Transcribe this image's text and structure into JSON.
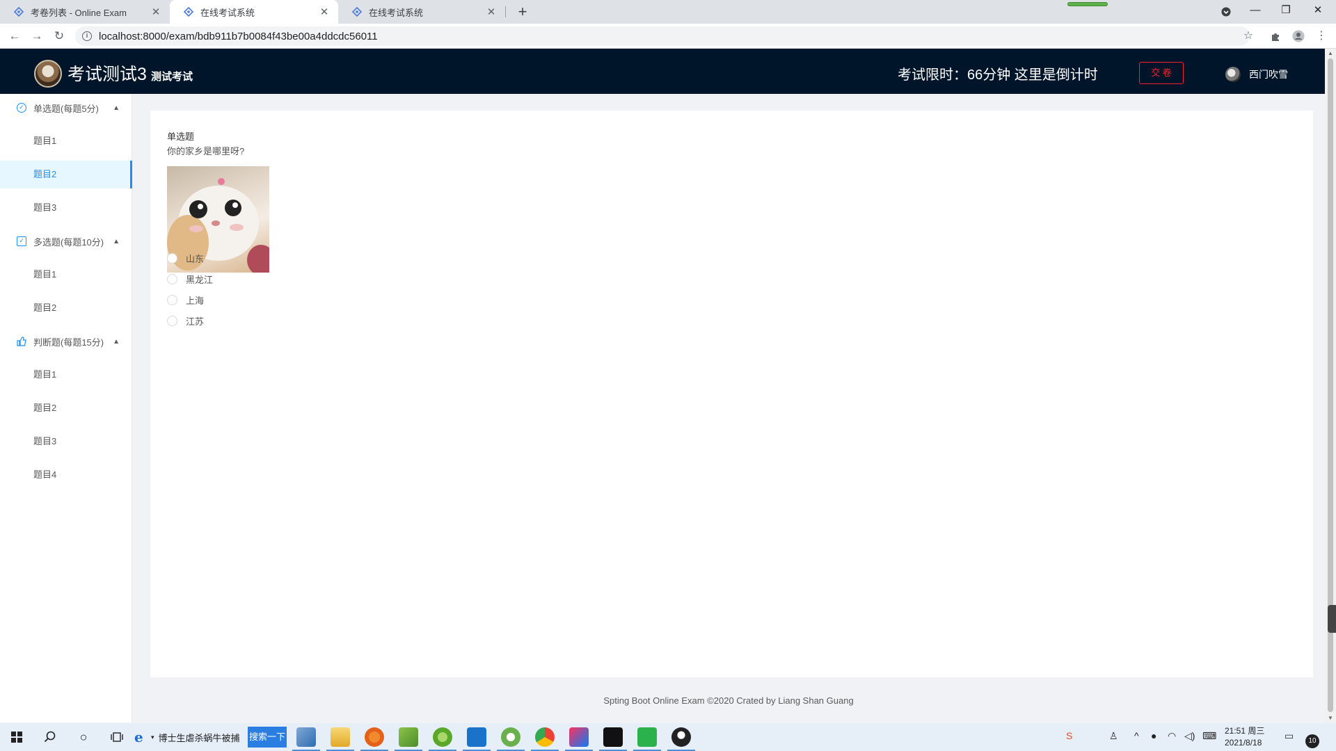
{
  "browser": {
    "tabs": [
      {
        "title": "考卷列表 - Online Exam"
      },
      {
        "title": "在线考试系统"
      },
      {
        "title": "在线考试系统"
      }
    ],
    "url": "localhost:8000/exam/bdb911b7b0084f43be00a4ddcdc56011"
  },
  "header": {
    "exam_title": "考试测试3",
    "exam_desc": "测试考试",
    "countdown": "考试限时：66分钟 这里是倒计时",
    "submit_label": "交 卷",
    "user_name": "西门吹雪"
  },
  "sidebar": {
    "groups": [
      {
        "label": "单选题(每题5分)",
        "items": [
          "题目1",
          "题目2",
          "题目3"
        ]
      },
      {
        "label": "多选题(每题10分)",
        "items": [
          "题目1",
          "题目2"
        ]
      },
      {
        "label": "判断题(每题15分)",
        "items": [
          "题目1",
          "题目2",
          "题目3",
          "题目4"
        ]
      }
    ],
    "selected": "题目2"
  },
  "question": {
    "type": "单选题",
    "text": "你的家乡是哪里呀?",
    "options": [
      "山东",
      "黑龙江",
      "上海",
      "江苏"
    ]
  },
  "footer": "Spting Boot Online Exam ©2020 Crated by Liang Shan Guang",
  "taskbar": {
    "search_text": "博士生虐杀蜗牛被捕",
    "search_button": "搜索一下",
    "clock_time": "21:51 周三",
    "clock_date": "2021/8/18",
    "notification_count": "10"
  },
  "colors": {
    "header_bg": "#001529",
    "accent": "#1890ff",
    "submit_red": "#f5222d",
    "selected_bg": "#e6f7ff"
  }
}
